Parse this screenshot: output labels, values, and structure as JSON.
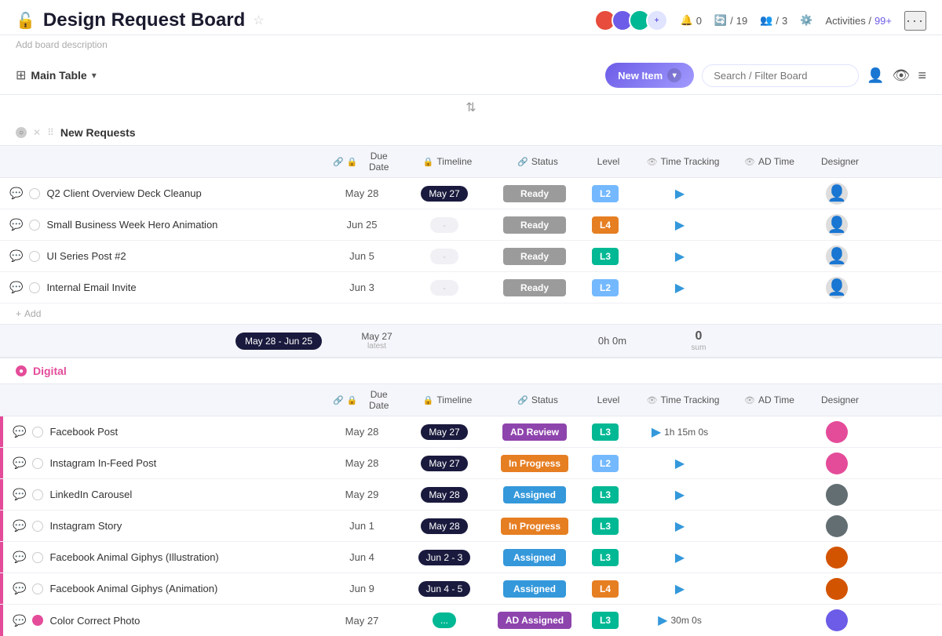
{
  "header": {
    "title": "Design Request Board",
    "description": "Add board description",
    "stats": {
      "notifications": "0",
      "updates": "19",
      "members": "3",
      "activities": "99+"
    }
  },
  "toolbar": {
    "table_name": "Main Table",
    "new_item_label": "New Item",
    "search_placeholder": "Search / Filter Board"
  },
  "groups": [
    {
      "name": "New Requests",
      "color": "gray",
      "items": [
        {
          "name": "Q2 Client Overview Deck Cleanup",
          "due_date": "May 28",
          "timeline": "May 27",
          "status": "Ready",
          "status_class": "status-ready",
          "level": "L2",
          "level_class": "level-l2",
          "time_tracking": "",
          "ad_time": ""
        },
        {
          "name": "Small Business Week Hero Animation",
          "due_date": "Jun 25",
          "timeline": "-",
          "status": "Ready",
          "status_class": "status-ready",
          "level": "L4",
          "level_class": "level-l4",
          "time_tracking": "",
          "ad_time": ""
        },
        {
          "name": "UI Series Post #2",
          "due_date": "Jun 5",
          "timeline": "-",
          "status": "Ready",
          "status_class": "status-ready",
          "level": "L3",
          "level_class": "level-l3",
          "time_tracking": "",
          "ad_time": ""
        },
        {
          "name": "Internal Email Invite",
          "due_date": "Jun 3",
          "timeline": "-",
          "status": "Ready",
          "status_class": "status-ready",
          "level": "L2",
          "level_class": "level-l2",
          "time_tracking": "",
          "ad_time": ""
        }
      ],
      "summary": {
        "date_range": "May 28 - Jun 25",
        "timeline_label": "May 27",
        "timeline_sub": "latest",
        "time_tracking": "0h 0m",
        "ad_time": "0",
        "ad_time_sub": "sum"
      }
    },
    {
      "name": "Digital",
      "color": "pink",
      "items": [
        {
          "name": "Facebook Post",
          "due_date": "May 28",
          "timeline": "May 27",
          "status": "AD Review",
          "status_class": "status-ad-review",
          "level": "L3",
          "level_class": "level-l3",
          "time_tracking": "1h 15m 0s",
          "ad_time": "",
          "has_avatar": true,
          "avatar_color": "av-pink"
        },
        {
          "name": "Instagram In-Feed Post",
          "due_date": "May 28",
          "timeline": "May 27",
          "status": "In Progress",
          "status_class": "status-in-progress",
          "level": "L2",
          "level_class": "level-l2",
          "time_tracking": "",
          "ad_time": "",
          "has_avatar": true,
          "avatar_color": "av-pink"
        },
        {
          "name": "LinkedIn Carousel",
          "due_date": "May 29",
          "timeline": "May 28",
          "status": "Assigned",
          "status_class": "status-assigned",
          "level": "L3",
          "level_class": "level-l3",
          "time_tracking": "",
          "ad_time": "",
          "has_avatar": true,
          "avatar_color": "av-teal"
        },
        {
          "name": "Instagram Story",
          "due_date": "Jun 1",
          "timeline": "May 28",
          "status": "In Progress",
          "status_class": "status-in-progress",
          "level": "L3",
          "level_class": "level-l3",
          "time_tracking": "",
          "ad_time": "",
          "has_avatar": true,
          "avatar_color": "av-teal"
        },
        {
          "name": "Facebook Animal Giphys (Illustration)",
          "due_date": "Jun 4",
          "timeline": "Jun 2 - 3",
          "status": "Assigned",
          "status_class": "status-assigned",
          "level": "L3",
          "level_class": "level-l3",
          "time_tracking": "",
          "ad_time": "",
          "has_avatar": true,
          "avatar_color": "av-orange"
        },
        {
          "name": "Facebook Animal Giphys (Animation)",
          "due_date": "Jun 9",
          "timeline": "Jun 4 - 5",
          "status": "Assigned",
          "status_class": "status-assigned",
          "level": "L4",
          "level_class": "level-l4",
          "time_tracking": "",
          "ad_time": "",
          "has_avatar": true,
          "avatar_color": "av-orange"
        },
        {
          "name": "Color Correct Photo",
          "due_date": "May 27",
          "timeline": "...",
          "status": "AD Assigned",
          "status_class": "status-ad-review",
          "level": "L3",
          "level_class": "level-l3",
          "time_tracking": "30m 0s",
          "ad_time": "",
          "has_avatar": true,
          "avatar_color": "av-purple"
        }
      ]
    }
  ],
  "col_headers": {
    "due_date": "Due Date",
    "timeline": "Timeline",
    "status": "Status",
    "level": "Level",
    "time_tracking": "Time Tracking",
    "ad_time": "AD Time",
    "designer": "Designer"
  }
}
